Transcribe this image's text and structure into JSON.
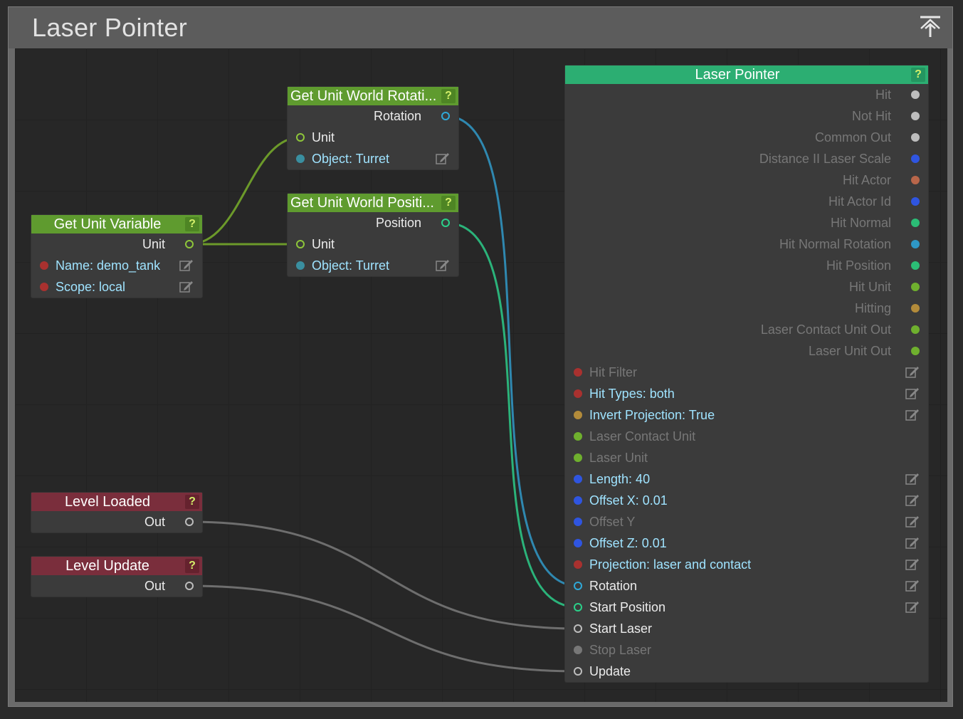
{
  "frame": {
    "title": "Laser Pointer"
  },
  "nodes": {
    "get_unit_variable": {
      "title": "Get Unit Variable",
      "help": "?",
      "out_unit": "Unit",
      "name_prop": "Name: demo_tank",
      "scope_prop": "Scope: local"
    },
    "rotation_node": {
      "title": "Get Unit World Rotati...",
      "help": "?",
      "out_rotation": "Rotation",
      "in_unit": "Unit",
      "object_prop": "Object: Turret"
    },
    "position_node": {
      "title": "Get Unit World Positi...",
      "help": "?",
      "out_position": "Position",
      "in_unit": "Unit",
      "object_prop": "Object: Turret"
    },
    "level_loaded": {
      "title": "Level Loaded",
      "help": "?",
      "out": "Out"
    },
    "level_update": {
      "title": "Level Update",
      "help": "?",
      "out": "Out"
    },
    "laser_pointer": {
      "title": "Laser Pointer",
      "help": "?",
      "outputs": [
        {
          "label": "Hit",
          "color": "#bdbdbd"
        },
        {
          "label": "Not Hit",
          "color": "#bdbdbd"
        },
        {
          "label": "Common Out",
          "color": "#bdbdbd"
        },
        {
          "label": "Distance II Laser Scale",
          "color": "#2f55e0"
        },
        {
          "label": "Hit Actor",
          "color": "#b8664a"
        },
        {
          "label": "Hit Actor Id",
          "color": "#2f55e0"
        },
        {
          "label": "Hit Normal",
          "color": "#2bbd76"
        },
        {
          "label": "Hit Normal Rotation",
          "color": "#2e97c6"
        },
        {
          "label": "Hit Position",
          "color": "#2bbd76"
        },
        {
          "label": "Hit Unit",
          "color": "#6fb02e"
        },
        {
          "label": "Hitting",
          "color": "#b38b3a"
        },
        {
          "label": "Laser Contact Unit Out",
          "color": "#6fb02e"
        },
        {
          "label": "Laser Unit Out",
          "color": "#6fb02e"
        }
      ],
      "inputs": [
        {
          "label": "Hit Filter",
          "color": "#a9312f",
          "state": "disabled",
          "editable": true
        },
        {
          "label": "Hit Types: both",
          "color": "#a9312f",
          "state": "prop",
          "editable": true
        },
        {
          "label": "Invert Projection: True",
          "color": "#b38b3a",
          "state": "prop",
          "editable": true
        },
        {
          "label": "Laser Contact Unit",
          "color": "#6fb02e",
          "state": "disabled",
          "editable": false
        },
        {
          "label": "Laser Unit",
          "color": "#6fb02e",
          "state": "disabled",
          "editable": false
        },
        {
          "label": "Length: 40",
          "color": "#2f55e0",
          "state": "prop",
          "editable": true
        },
        {
          "label": "Offset X: 0.01",
          "color": "#2f55e0",
          "state": "prop",
          "editable": true
        },
        {
          "label": "Offset Y",
          "color": "#2f55e0",
          "state": "disabled",
          "editable": true
        },
        {
          "label": "Offset Z: 0.01",
          "color": "#2f55e0",
          "state": "prop",
          "editable": true
        },
        {
          "label": "Projection: laser and contact",
          "color": "#a9312f",
          "state": "prop",
          "editable": true
        },
        {
          "label": "Rotation",
          "color": "#2fa9d8",
          "state": "ring",
          "editable": true
        },
        {
          "label": "Start Position",
          "color": "#2bd18a",
          "state": "ring",
          "editable": true
        },
        {
          "label": "Start Laser",
          "color": "#bdbdbd",
          "state": "ring",
          "editable": false
        },
        {
          "label": "Stop Laser",
          "color": "#777777",
          "state": "disabled",
          "editable": false
        },
        {
          "label": "Update",
          "color": "#bdbdbd",
          "state": "ring",
          "editable": false
        }
      ]
    }
  },
  "colors": {
    "unit_wire": "#6c9a2a",
    "rotation_wire": "#2f88b0",
    "position_wire": "#2bb37a",
    "event_wire": "#6e6e6e"
  }
}
